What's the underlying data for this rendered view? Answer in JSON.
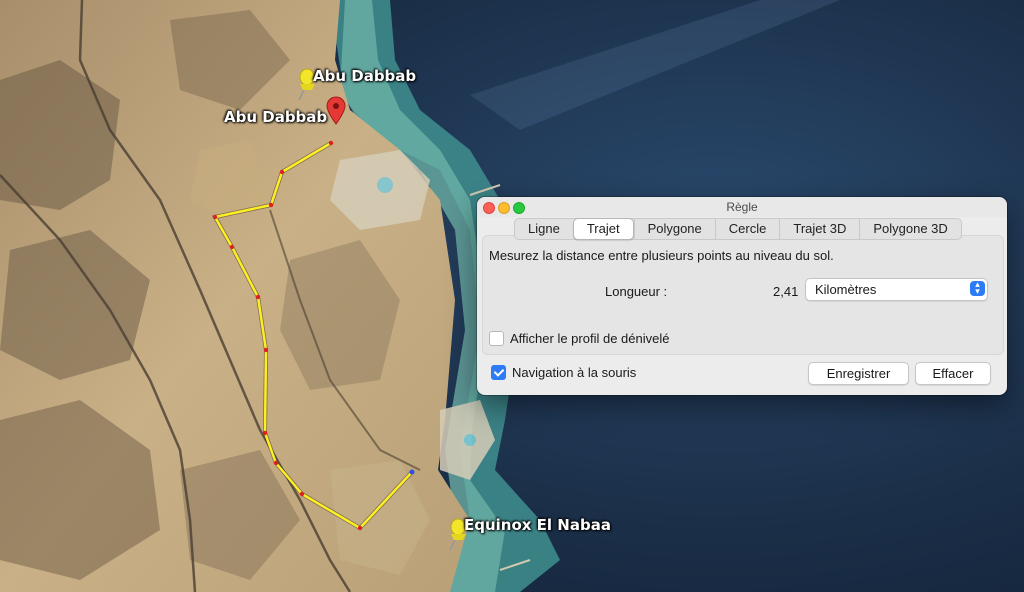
{
  "map": {
    "placemarks": [
      {
        "label": "Abu Dabbab",
        "icon": "yellow-pushpin-icon"
      },
      {
        "label": "Abu Dabbab",
        "icon": "red-location-pin-icon"
      },
      {
        "label": "Equinox El Nabaa",
        "icon": "yellow-pushpin-icon"
      }
    ],
    "path_color": "#ffee22",
    "vertex_color": "#e02020"
  },
  "ruler": {
    "title": "Règle",
    "tabs": [
      "Ligne",
      "Trajet",
      "Polygone",
      "Cercle",
      "Trajet 3D",
      "Polygone 3D"
    ],
    "active_tab": "Trajet",
    "description": "Mesurez la distance entre plusieurs points au niveau du sol.",
    "length_label": "Longueur :",
    "length_value": "2,41",
    "unit": "Kilomètres",
    "elevation_profile": {
      "label": "Afficher le profil de dénivelé",
      "checked": false
    },
    "mouse_navigation": {
      "label": "Navigation à la souris",
      "checked": true
    },
    "save_label": "Enregistrer",
    "clear_label": "Effacer",
    "accent_color": "#2d7cf6"
  }
}
